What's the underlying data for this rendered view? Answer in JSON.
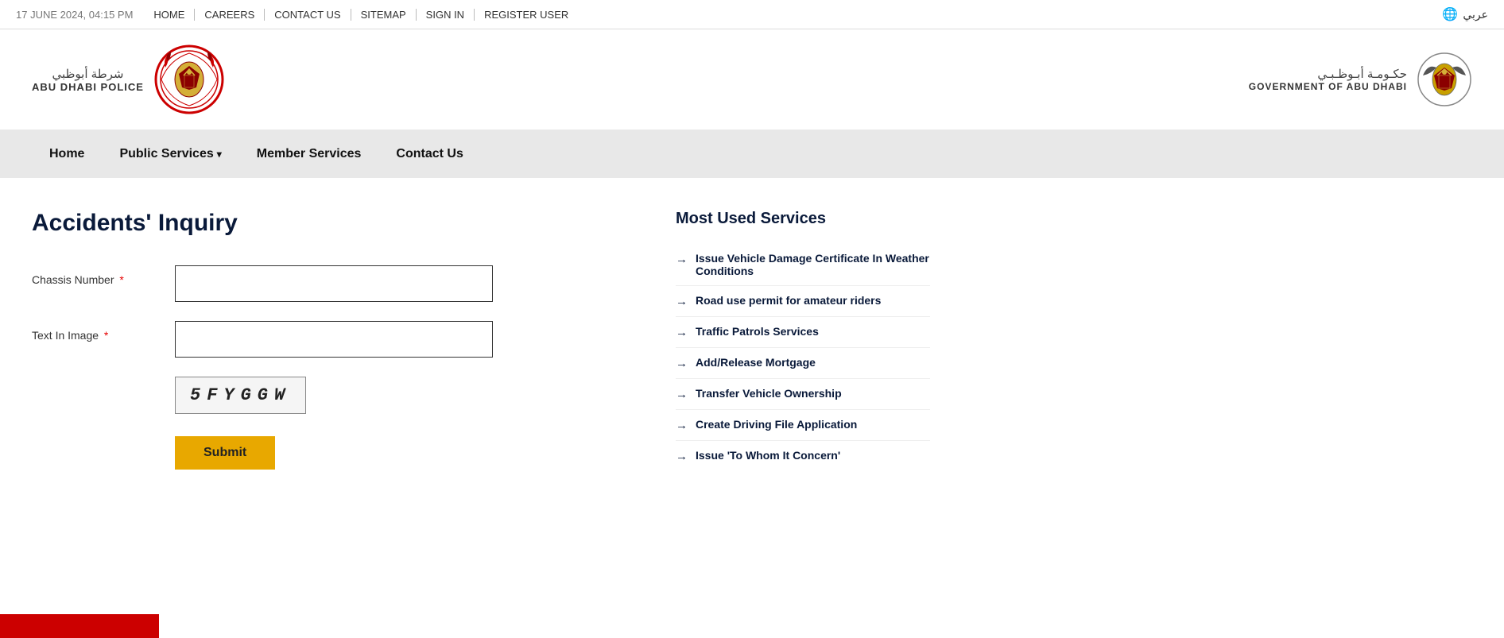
{
  "topbar": {
    "date": "17 JUNE 2024, 04:15 PM",
    "links": [
      {
        "label": "HOME",
        "id": "home"
      },
      {
        "label": "CAREERS",
        "id": "careers"
      },
      {
        "label": "CONTACT US",
        "id": "contact-us"
      },
      {
        "label": "SITEMAP",
        "id": "sitemap"
      },
      {
        "label": "SIGN IN",
        "id": "sign-in"
      },
      {
        "label": "REGISTER USER",
        "id": "register-user"
      }
    ],
    "lang_label": "عربي"
  },
  "header": {
    "logo_arabic": "شرطة أبوظبي",
    "logo_english": "ABU DHABI POLICE",
    "gov_arabic": "حكـومـة أبـوظـبـي",
    "gov_english": "GOVERNMENT OF ABU DHABI"
  },
  "nav": {
    "items": [
      {
        "label": "Home",
        "has_arrow": false
      },
      {
        "label": "Public Services",
        "has_arrow": true
      },
      {
        "label": "Member Services",
        "has_arrow": false
      },
      {
        "label": "Contact Us",
        "has_arrow": false
      }
    ]
  },
  "form": {
    "page_title": "Accidents' Inquiry",
    "chassis_label": "Chassis Number",
    "text_in_image_label": "Text In Image",
    "required_symbol": "*",
    "captcha_text": "5FYGGW",
    "submit_label": "Submit",
    "chassis_placeholder": "",
    "captcha_placeholder": ""
  },
  "sidebar": {
    "title": "Most Used Services",
    "items": [
      {
        "label": "Issue Vehicle Damage Certificate In Weather Conditions"
      },
      {
        "label": "Road use permit for amateur riders"
      },
      {
        "label": "Traffic Patrols Services"
      },
      {
        "label": "Add/Release Mortgage"
      },
      {
        "label": "Transfer Vehicle Ownership"
      },
      {
        "label": "Create Driving File Application"
      },
      {
        "label": "Issue 'To Whom It Concern'"
      }
    ]
  }
}
